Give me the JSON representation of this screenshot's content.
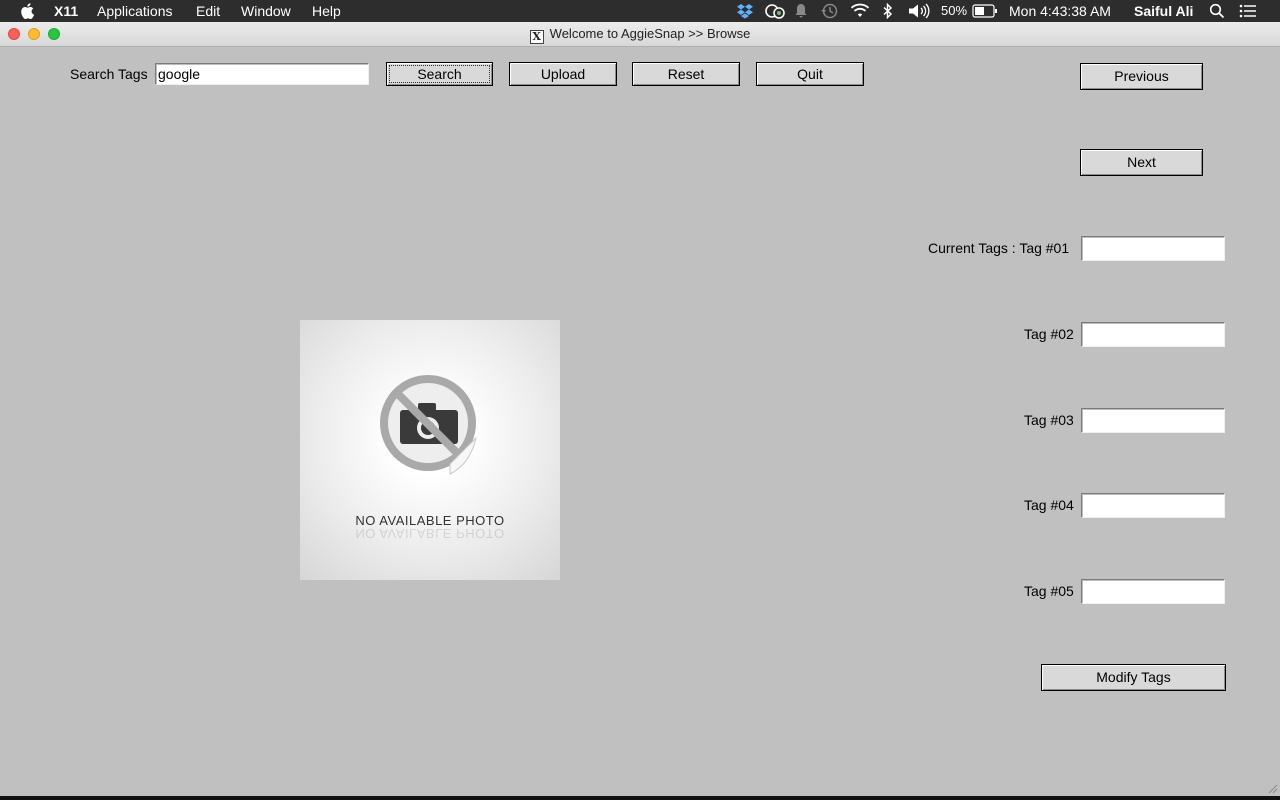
{
  "menubar": {
    "app_name": "X11",
    "menus": [
      "Applications",
      "Edit",
      "Window",
      "Help"
    ],
    "battery": "50%",
    "clock": "Mon 4:43:38 AM",
    "user": "Saiful Ali",
    "status_icons": [
      "dropbox-icon",
      "sync-icon",
      "notification-icon",
      "time-machine-icon",
      "wifi-icon",
      "bluetooth-icon",
      "volume-icon",
      "battery-icon",
      "spotlight-icon",
      "notification-center-icon"
    ]
  },
  "window": {
    "title": "Welcome to AggieSnap >> Browse",
    "x_logo": "X"
  },
  "toolbar": {
    "search_label": "Search Tags",
    "search_value": "google",
    "search_button": "Search",
    "upload_button": "Upload",
    "reset_button": "Reset",
    "quit_button": "Quit"
  },
  "nav": {
    "previous_button": "Previous",
    "next_button": "Next"
  },
  "photo": {
    "caption": "NO AVAILABLE PHOTO"
  },
  "tags": {
    "current_prefix": "Current Tags :",
    "items": [
      {
        "label": "Tag #01",
        "value": ""
      },
      {
        "label": "Tag #02",
        "value": ""
      },
      {
        "label": "Tag #03",
        "value": ""
      },
      {
        "label": "Tag #04",
        "value": ""
      },
      {
        "label": "Tag #05",
        "value": ""
      }
    ],
    "modify_button": "Modify Tags"
  },
  "colors": {
    "window_bg": "#c0c0c0",
    "menubar_bg": "#2d2d2d",
    "button_bg": "#d9d9d9"
  }
}
